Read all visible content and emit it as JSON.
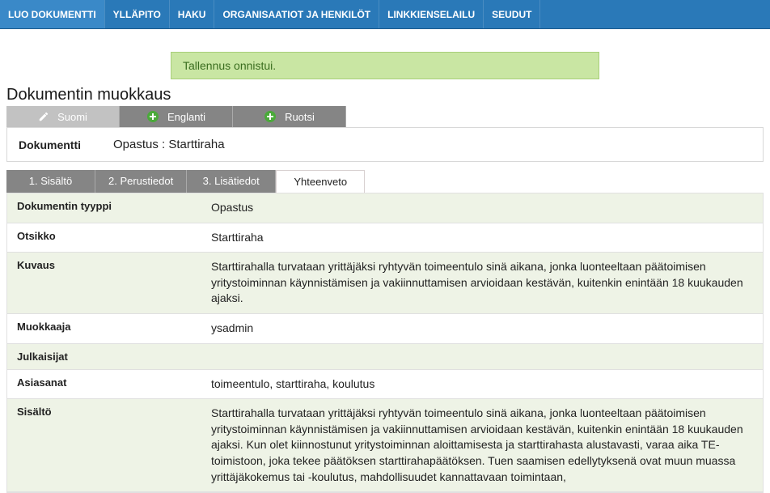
{
  "topnav": [
    "LUO DOKUMENTTI",
    "YLLÄPITO",
    "HAKU",
    "ORGANISAATIOT JA HENKILÖT",
    "LINKKIENSELAILU",
    "SEUDUT"
  ],
  "notice": "Tallennus onnistui.",
  "pageTitle": "Dokumentin muokkaus",
  "langTabs": {
    "active": "Suomi",
    "others": [
      "Englanti",
      "Ruotsi"
    ]
  },
  "document": {
    "label": "Dokumentti",
    "value": "Opastus : Starttiraha"
  },
  "stepTabs": [
    "1. Sisältö",
    "2. Perustiedot",
    "3. Lisätiedot",
    "Yhteenveto"
  ],
  "activeStep": 3,
  "details": [
    {
      "label": "Dokumentin tyyppi",
      "value": "Opastus"
    },
    {
      "label": "Otsikko",
      "value": "Starttiraha"
    },
    {
      "label": "Kuvaus",
      "value": "Starttirahalla turvataan yrittäjäksi ryhtyvän toimeentulo sinä aikana, jonka luonteeltaan päätoimisen yritystoiminnan käynnistämisen ja vakiinnuttamisen arvioidaan kestävän, kuitenkin enintään 18 kuukauden ajaksi."
    },
    {
      "label": "Muokkaaja",
      "value": "ysadmin"
    },
    {
      "label": "Julkaisijat",
      "value": ""
    },
    {
      "label": "Asiasanat",
      "value": "toimeentulo, starttiraha, koulutus"
    },
    {
      "label": "Sisältö",
      "value": "Starttirahalla turvataan yrittäjäksi ryhtyvän toimeentulo sinä aikana, jonka luonteeltaan päätoimisen yritystoiminnan käynnistämisen ja vakiinnuttamisen arvioidaan kestävän, kuitenkin enintään 18 kuukauden ajaksi. Kun olet kiinnostunut yritystoiminnan aloittamisesta ja starttirahasta alustavasti, varaa aika TE-toimistoon, joka tekee päätöksen starttirahapäätöksen. Tuen saamisen edellytyksenä ovat muun muassa yrittäjäkokemus tai -koulutus, mahdollisuudet kannattavaan toimintaan,"
    }
  ]
}
